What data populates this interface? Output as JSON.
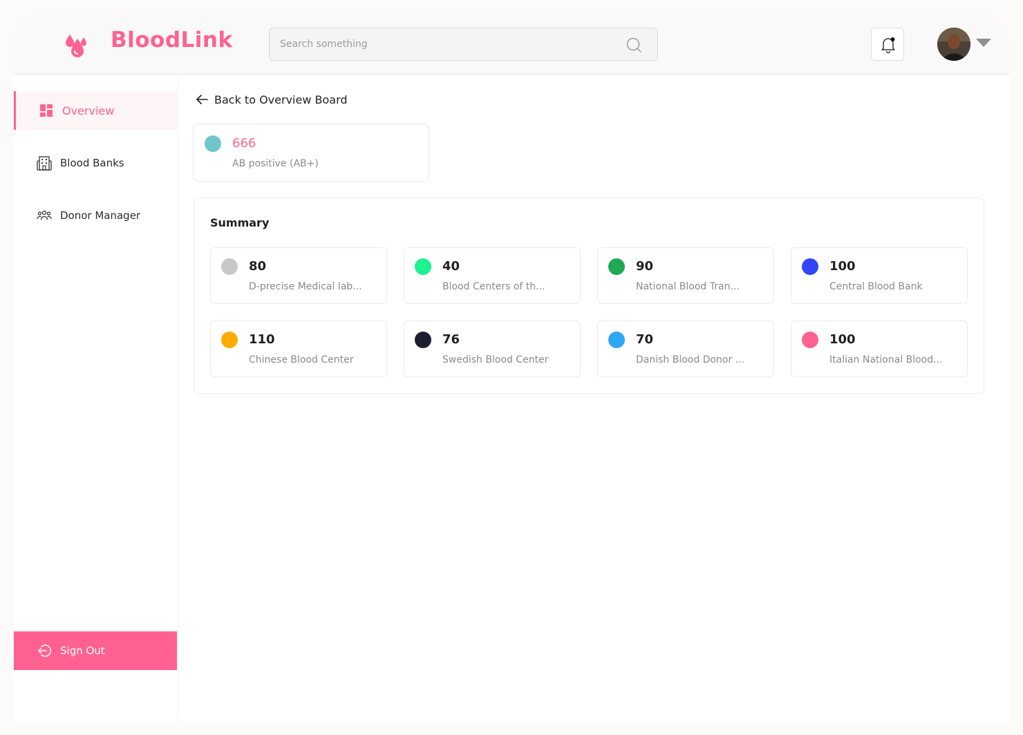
{
  "app": {
    "name": "BloodLink"
  },
  "header": {
    "search_placeholder": "Search something",
    "icons": {
      "logo": "blood-drops-icon",
      "search": "search-icon",
      "notification": "bell-icon",
      "menu": "chevron-down-icon"
    }
  },
  "sidebar": {
    "items": [
      {
        "label": "Overview",
        "icon": "dashboard-grid-icon",
        "active": true
      },
      {
        "label": "Blood Banks",
        "icon": "building-icon",
        "active": false
      },
      {
        "label": "Donor Manager",
        "icon": "people-group-icon",
        "active": false
      }
    ],
    "signout_label": "Sign Out"
  },
  "main": {
    "back_label": "Back to Overview Board",
    "highlight": {
      "value": "666",
      "label": "AB positive (AB+)",
      "color": "#6ec6ca"
    },
    "summary_title": "Summary",
    "summary": [
      {
        "value": "80",
        "label": "D-precise Medical lab...",
        "color": "#c8c8c8"
      },
      {
        "value": "40",
        "label": "Blood Centers of th...",
        "color": "#1cf28e"
      },
      {
        "value": "90",
        "label": "National Blood Tran...",
        "color": "#21a853"
      },
      {
        "value": "100",
        "label": "Central Blood Bank",
        "color": "#3345f4"
      },
      {
        "value": "110",
        "label": "Chinese Blood Center",
        "color": "#ffab00"
      },
      {
        "value": "76",
        "label": "Swedish Blood Center",
        "color": "#1d1f2e"
      },
      {
        "value": "70",
        "label": "Danish Blood Donor ...",
        "color": "#2ea7f5"
      },
      {
        "value": "100",
        "label": "Italian National Blood...",
        "color": "#ff6290"
      }
    ]
  },
  "colors": {
    "brand": "#ff6290",
    "text": "#1f1f1f",
    "muted": "#8a8a8a"
  }
}
